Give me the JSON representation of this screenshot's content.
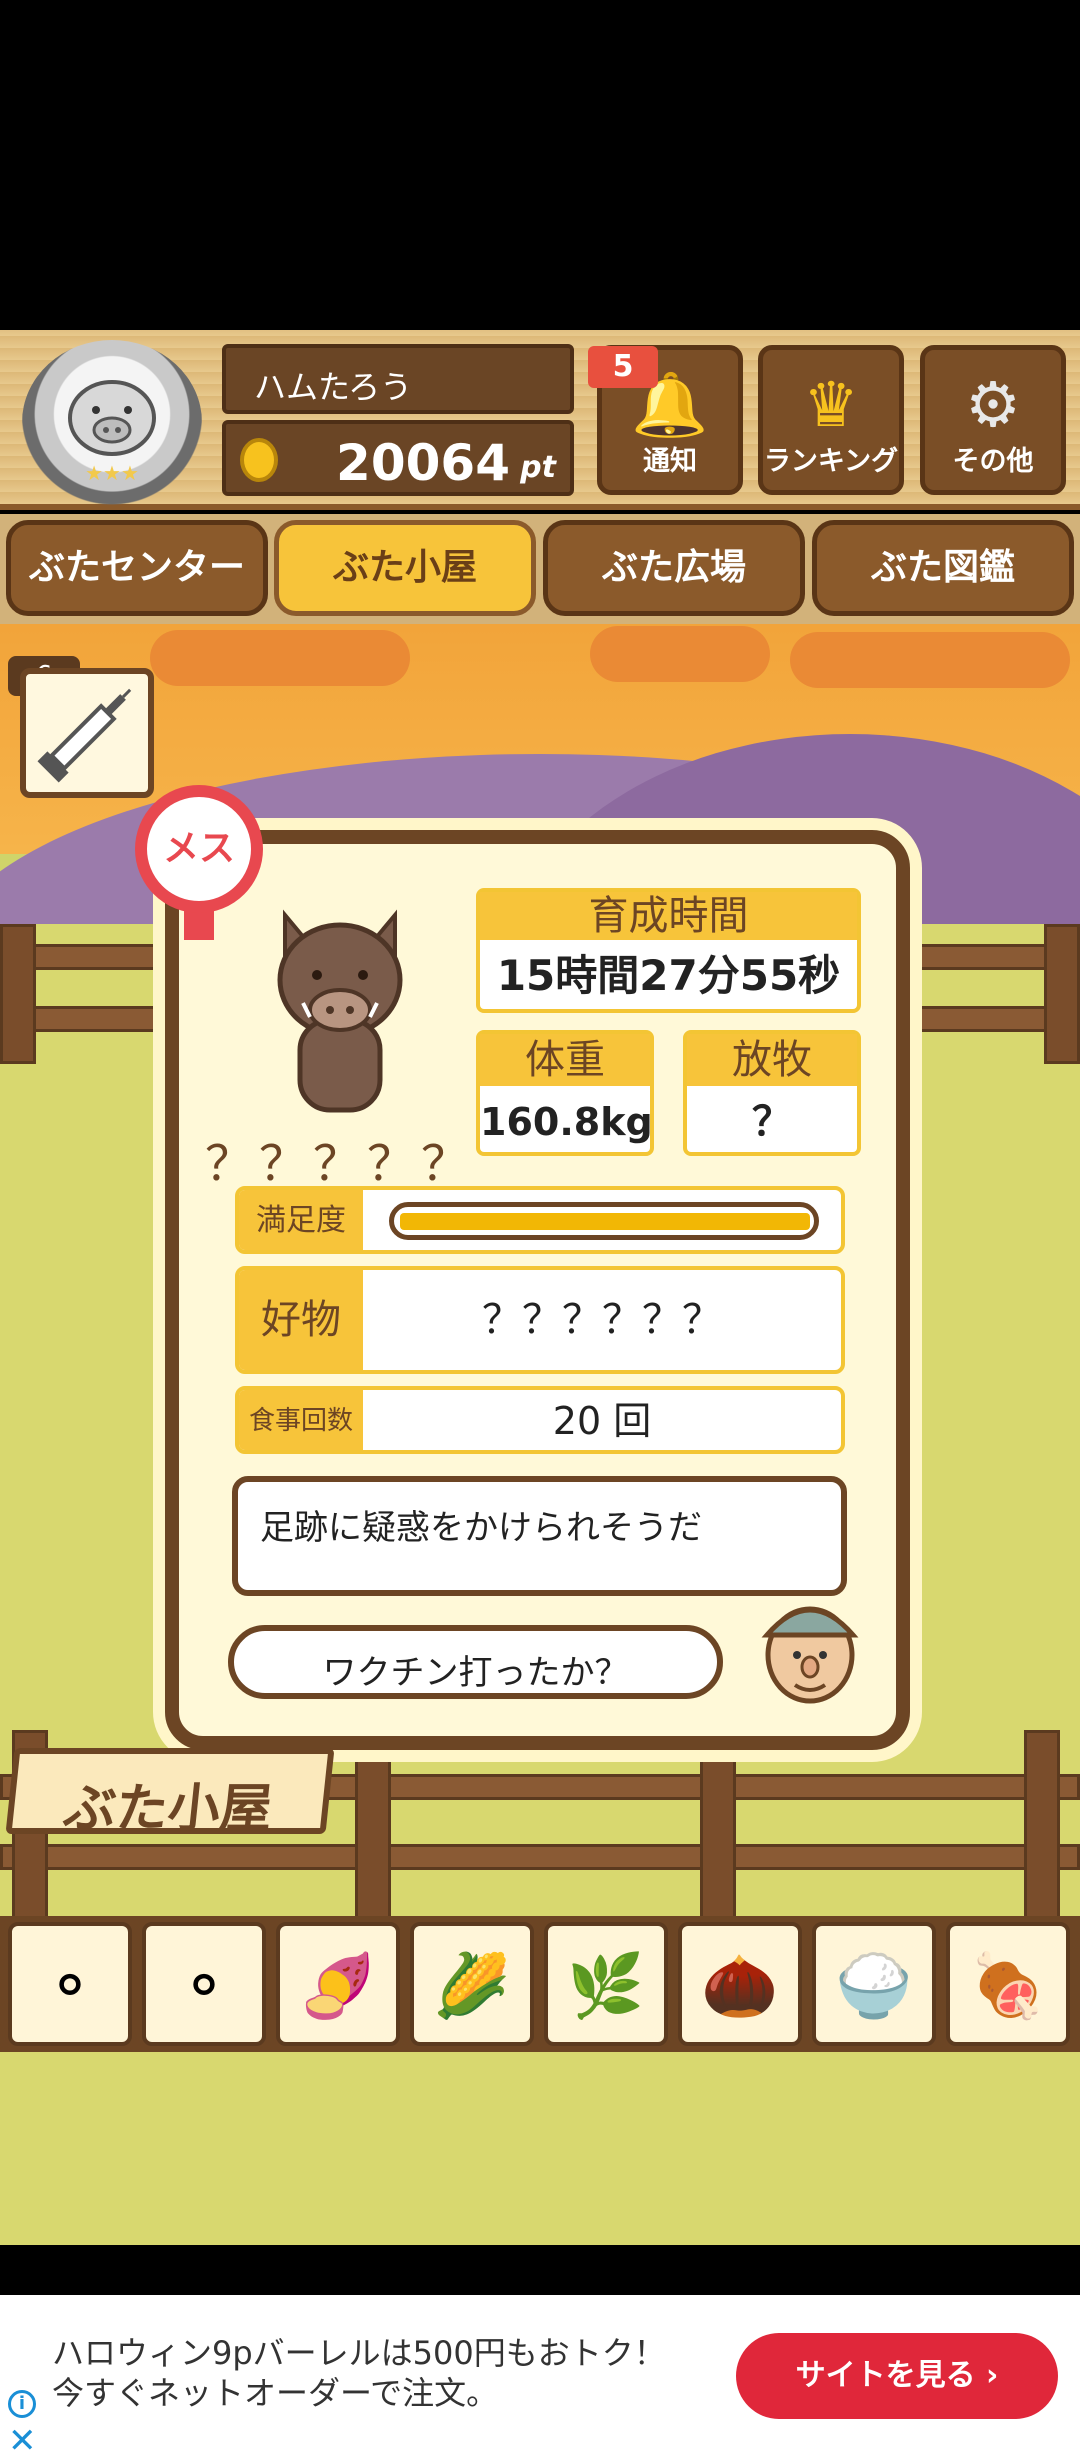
{
  "header": {
    "player_name": "ハムたろう",
    "points": "20064",
    "points_unit": "pt",
    "notification_count": "5",
    "buttons": [
      {
        "label": "通知",
        "icon": "bell-icon"
      },
      {
        "label": "ランキング",
        "icon": "crown-icon"
      },
      {
        "label": "その他",
        "icon": "gear-icon"
      }
    ]
  },
  "tabs": [
    {
      "label": "ぶたセンター"
    },
    {
      "label": "ぶた小屋"
    },
    {
      "label": "ぶた広場"
    },
    {
      "label": "ぶた図鑑"
    }
  ],
  "syringe_count": "6",
  "pig": {
    "gender_label": "メス",
    "name": "？？？？？",
    "growth_time_label": "育成時間",
    "growth_time": "15時間27分55秒",
    "weight_label": "体重",
    "weight": "160.8kg",
    "grazing_label": "放牧",
    "grazing": "？",
    "satisfaction_label": "満足度",
    "satisfaction_level": 1.0,
    "favorite_label": "好物",
    "favorite": "？？？？？？",
    "meals_label": "食事回数",
    "meals": "20 回"
  },
  "speech": {
    "message": "足跡に疑惑をかけられそうだ",
    "question": "ワクチン打ったか？"
  },
  "sign": "ぶた小屋",
  "foods": [
    "grain-icon",
    "grain-mix-icon",
    "sweet-potato-icon",
    "corn-icon",
    "beans-icon",
    "acorn-icon",
    "rice-plate-icon",
    "meatball-plate-icon"
  ],
  "ad": {
    "text": "ハロウィン9pバーレルは500円もおトク！今すぐネットオーダーで注文。",
    "button": "サイトを見る ›",
    "info": "i",
    "close": "✕"
  },
  "colors": {
    "accent": "#f7c43a",
    "wood": "#6c4524",
    "female": "#e8484f",
    "ad_button": "#e0273a"
  }
}
